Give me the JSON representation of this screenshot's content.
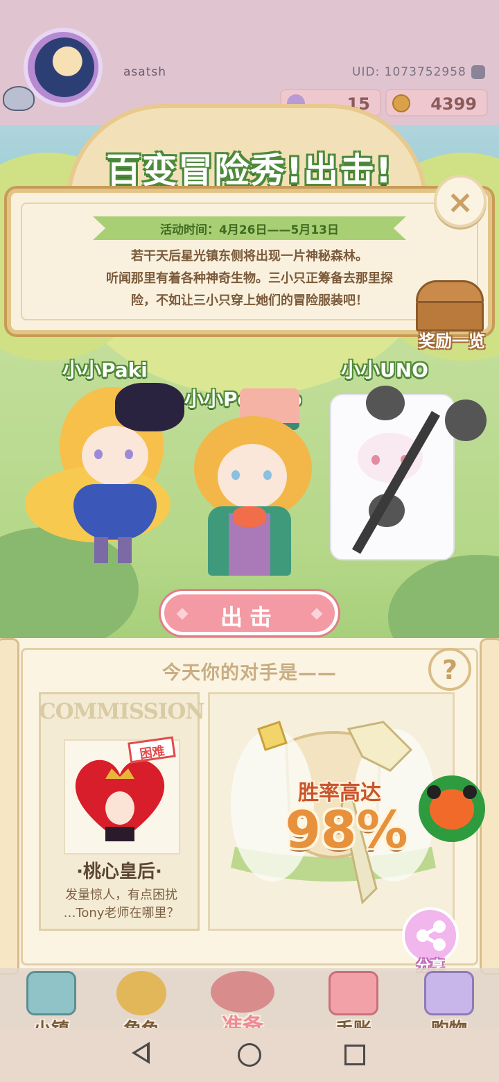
{
  "user": {
    "username": "asatsh",
    "uid_label": "UID: 1073752958",
    "stat_gems": "15",
    "stat_coins": "4399"
  },
  "event": {
    "title": "百变冒险秀!出击!",
    "date": "活动时间：4月26日——5月13日",
    "desc_line1": "若干天后星光镇东侧将出现一片神秘森林。",
    "desc_line2": "听闻那里有着各种神奇生物。三小只正筹备去那里探",
    "desc_line3": "险，不如让三小只穿上她们的冒险服装吧！",
    "close_icon": "×",
    "rewards_label": "奖励一览"
  },
  "characters": [
    {
      "name": "小小Paki"
    },
    {
      "name": "小小Peacoo"
    },
    {
      "name": "小小UNO"
    }
  ],
  "attack_button": "出击",
  "opponent": {
    "section_title": "今天你的对手是——",
    "help_icon": "?",
    "poster_title": "COMMISSION",
    "difficulty": "困难",
    "name": "·桃心皇后·",
    "desc_line1": "发量惊人，有点困扰",
    "desc_line2": "…Tony老师在哪里？",
    "win_label": "胜率高达",
    "win_rate": "98%"
  },
  "share_label": "分享",
  "tabs": [
    {
      "label": "小镇",
      "icon": "map-icon"
    },
    {
      "label": "角色",
      "icon": "character-icon"
    },
    {
      "label": "准备",
      "icon": "wardrobe-icon"
    },
    {
      "label": "手账",
      "icon": "journal-icon"
    },
    {
      "label": "购物",
      "icon": "shopping-bag-icon"
    }
  ],
  "colors": {
    "accent_green": "#4c8a3a",
    "button_pink": "#f49aa4",
    "board_cream": "#fbf4e2",
    "difficulty_red": "#e14b4b",
    "win_orange": "#e7913c"
  }
}
